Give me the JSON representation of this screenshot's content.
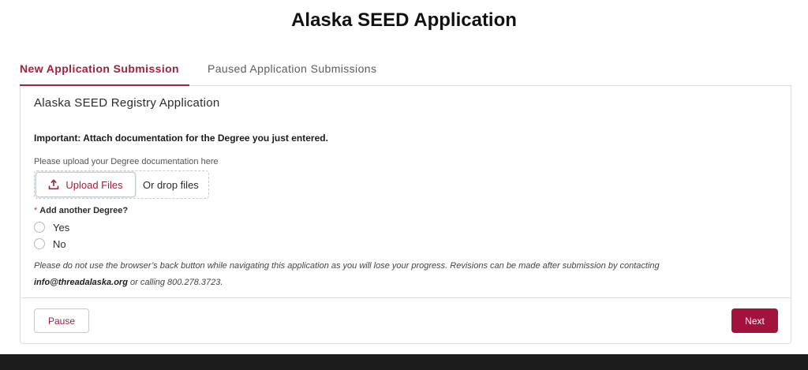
{
  "page": {
    "title": "Alaska SEED Application"
  },
  "tabs": [
    {
      "label": "New Application Submission",
      "active": true
    },
    {
      "label": "Paused Application Submissions",
      "active": false
    }
  ],
  "form": {
    "card_title": "Alaska SEED Registry Application",
    "important_text": "Important: Attach documentation for the Degree you just entered.",
    "upload": {
      "label": "Please upload your Degree documentation here",
      "button_label": "Upload Files",
      "drop_text": "Or drop files",
      "icon": "upload-icon"
    },
    "question": {
      "required_marker": "*",
      "label": "Add another Degree?",
      "options": [
        {
          "label": "Yes",
          "selected": false
        },
        {
          "label": "No",
          "selected": false
        }
      ]
    },
    "notice": {
      "text_before": "Please do not use the browser’s back button while navigating this application as you will lose your progress. Revisions can be made after submission by contacting ",
      "email": "info@threadalaska.org",
      "text_after": " or calling 800.278.3723."
    }
  },
  "footer": {
    "pause_label": "Pause",
    "next_label": "Next"
  },
  "colors": {
    "accent": "#a3203e",
    "next_button": "#a3123d",
    "bottom_bar": "#1c1c1c"
  }
}
